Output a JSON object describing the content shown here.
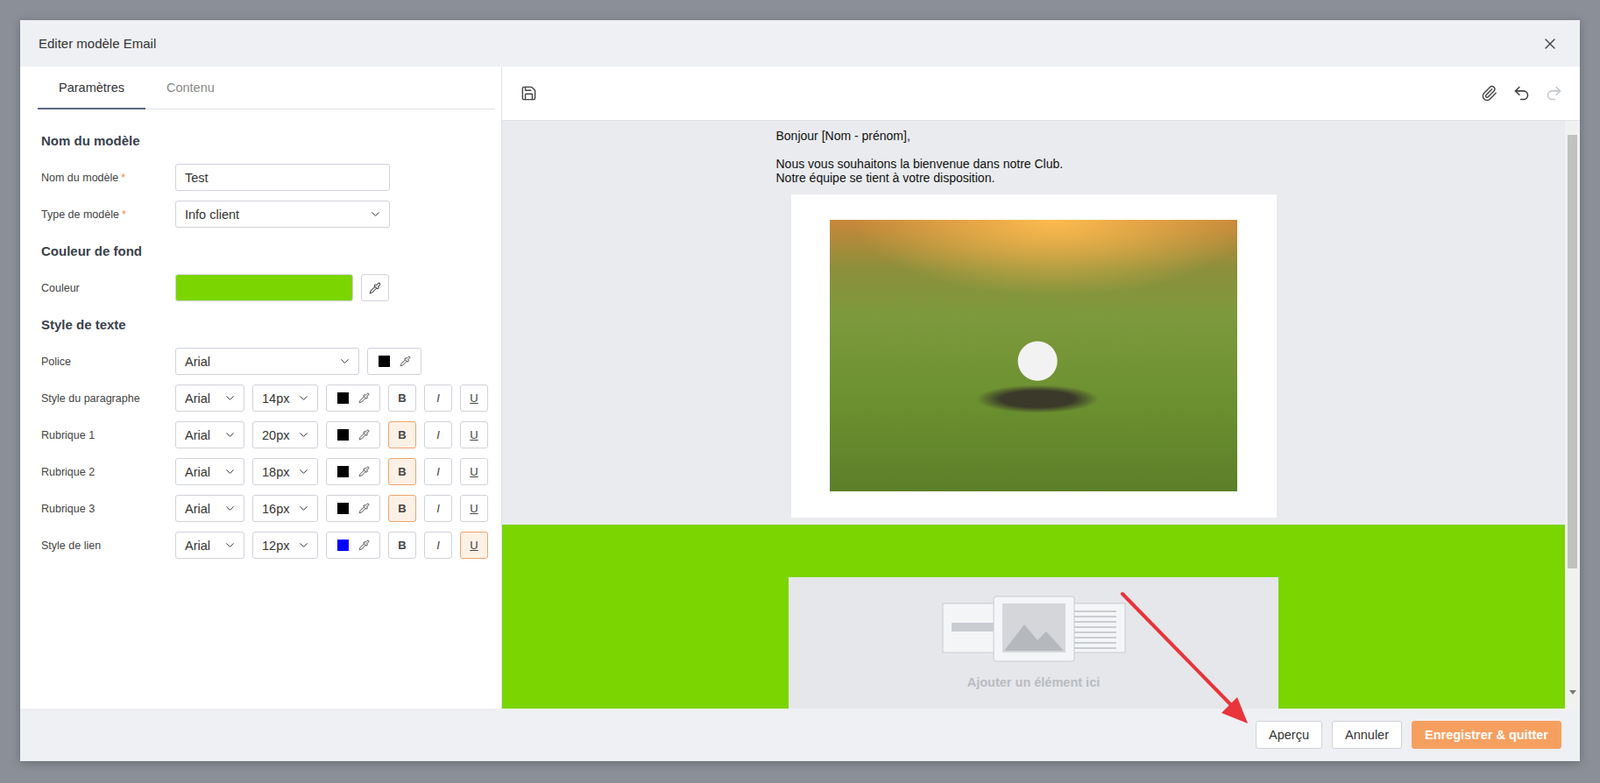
{
  "window": {
    "title": "Editer modèle Email"
  },
  "tabs": [
    {
      "label": "Paramètres",
      "selected": true
    },
    {
      "label": "Contenu",
      "selected": false
    }
  ],
  "required_mark": "*",
  "format_labels": [
    "B",
    "I",
    "U"
  ],
  "settings": {
    "name_section": "Nom du modèle",
    "fields": [
      {
        "label": "Nom du modèle",
        "required": true,
        "kind": "input",
        "value": "Test"
      },
      {
        "label": "Type de modèle",
        "required": true,
        "kind": "select",
        "value": "Info client"
      }
    ],
    "background": {
      "title": "Couleur de fond",
      "label": "Couleur",
      "color": "#7bd500"
    },
    "text_style": {
      "title": "Style de texte",
      "font": {
        "label": "Police",
        "value": "Arial",
        "color": "#000000"
      },
      "rows": [
        {
          "label": "Style du paragraphe",
          "font": "Arial",
          "size": "14px",
          "color": "#000000",
          "bold": false,
          "italic": false,
          "underline": false
        },
        {
          "label": "Rubrique 1",
          "font": "Arial",
          "size": "20px",
          "color": "#000000",
          "bold": true,
          "italic": false,
          "underline": false
        },
        {
          "label": "Rubrique 2",
          "font": "Arial",
          "size": "18px",
          "color": "#000000",
          "bold": true,
          "italic": false,
          "underline": false
        },
        {
          "label": "Rubrique 3",
          "font": "Arial",
          "size": "16px",
          "color": "#000000",
          "bold": true,
          "italic": false,
          "underline": false
        },
        {
          "label": "Style de lien",
          "font": "Arial",
          "size": "12px",
          "color": "#0000ff",
          "bold": false,
          "italic": false,
          "underline": true
        }
      ]
    }
  },
  "toolbar": {
    "undo_disabled": false,
    "redo_disabled": true
  },
  "editor": {
    "lines": [
      "Bonjour [Nom - prénom],",
      "",
      "Nous vous souhaitons la bienvenue dans notre Club.",
      "Notre équipe se tient à votre disposition."
    ],
    "band_color": "#7bd500",
    "placeholder": "Ajouter un élément ici"
  },
  "buttons": [
    {
      "label": "Aperçu",
      "kind": "secondary"
    },
    {
      "label": "Annuler",
      "kind": "secondary"
    },
    {
      "label": "Enregistrer & quitter",
      "kind": "primary"
    }
  ]
}
